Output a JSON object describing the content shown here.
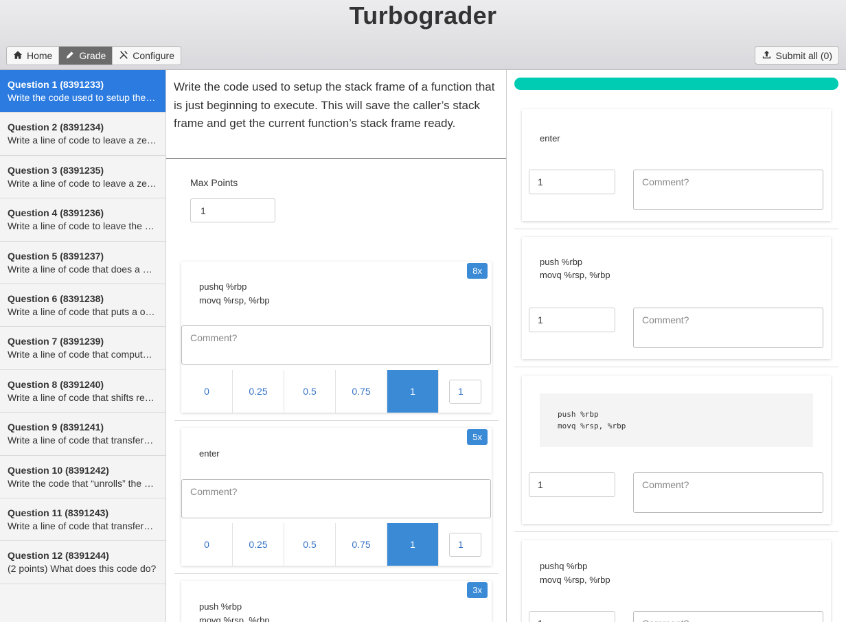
{
  "app": {
    "title": "Turbograder"
  },
  "nav": {
    "home": "Home",
    "grade": "Grade",
    "configure": "Configure",
    "submit": "Submit all (0)"
  },
  "questions": [
    {
      "title": "Question 1 (8391233)",
      "summary": "Write the code used to setup the stack frame of a function"
    },
    {
      "title": "Question 2 (8391234)",
      "summary": "Write a line of code to leave a zero in a register"
    },
    {
      "title": "Question 3 (8391235)",
      "summary": "Write a line of code to leave a zero in a register"
    },
    {
      "title": "Question 4 (8391236)",
      "summary": "Write a line of code to leave the value in a register"
    },
    {
      "title": "Question 5 (8391237)",
      "summary": "Write a line of code that does a bitwise operation"
    },
    {
      "title": "Question 6 (8391238)",
      "summary": "Write a line of code that puts a one in a register"
    },
    {
      "title": "Question 7 (8391239)",
      "summary": "Write a line of code that computes an address"
    },
    {
      "title": "Question 8 (8391240)",
      "summary": "Write a line of code that shifts register bits"
    },
    {
      "title": "Question 9 (8391241)",
      "summary": "Write a line of code that transfers a value"
    },
    {
      "title": "Question 10 (8391242)",
      "summary": "Write the code that “unrolls” the stack frame"
    },
    {
      "title": "Question 11 (8391243)",
      "summary": "Write a line of code that transfers a value"
    },
    {
      "title": "Question 12 (8391244)",
      "summary": "(2 points) What does this code do?"
    }
  ],
  "prompt": "Write the code used to setup the stack frame of a function that is just beginning to execute.  This will save the caller’s stack frame and get the current function’s stack frame ready.",
  "max_points": {
    "label": "Max Points",
    "value": "1"
  },
  "answers": [
    {
      "count": "8x",
      "text": "pushq %rbp\nmovq %rsp, %rbp",
      "comment_placeholder": "Comment?",
      "scores": [
        "0",
        "0.25",
        "0.5",
        "0.75",
        "1"
      ],
      "selected": "1",
      "input": "1"
    },
    {
      "count": "5x",
      "text": "enter",
      "comment_placeholder": "Comment?",
      "scores": [
        "0",
        "0.25",
        "0.5",
        "0.75",
        "1"
      ],
      "selected": "1",
      "input": "1"
    },
    {
      "count": "3x",
      "text": "push %rbp\nmovq %rsp, %rbp"
    }
  ],
  "progress": 1.0,
  "submissions": [
    {
      "text": "enter",
      "score": "1",
      "comment_placeholder": "Comment?"
    },
    {
      "text": "push %rbp\nmovq %rsp, %rbp",
      "score": "1",
      "comment_placeholder": "Comment?"
    },
    {
      "code": "push %rbp\nmovq %rsp, %rbp",
      "score": "1",
      "comment_placeholder": "Comment?"
    },
    {
      "text": "pushq %rbp\nmovq %rsp, %rbp",
      "score": "1",
      "comment_placeholder": "Comment?"
    }
  ],
  "colors": {
    "accent": "#3a8ad6",
    "progress": "#00ccb4",
    "active_question": "#2b7be0"
  }
}
